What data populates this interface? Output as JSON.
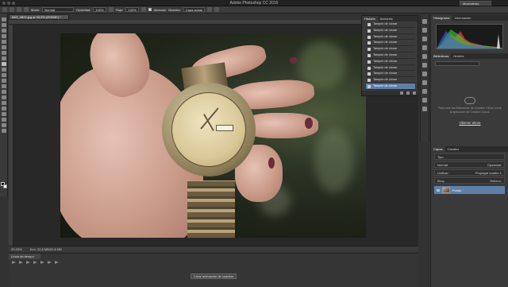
{
  "window": {
    "title": "Adobe Photoshop CC 2015",
    "workspace": "Movimiento"
  },
  "options_bar": {
    "mode_label": "Modo:",
    "mode_value": "Normal",
    "opacity_label": "Opacidad:",
    "opacity_value": "100%",
    "flow_label": "Flujo:",
    "flow_value": "100%",
    "aligned_label": "Alineado",
    "sample_label": "Muestra:",
    "sample_value": "Capa actual"
  },
  "document": {
    "tab_title": "IMG_0822.jpg al 33,3% (RGB/8*) *",
    "zoom": "33,33%",
    "doc_info": "Doc: 22,8 MB/22,8 MB"
  },
  "history_panel": {
    "tabs": [
      "Historia",
      "Acciones"
    ],
    "items": [
      "Tampón de clonar",
      "Tampón de clonar",
      "Tampón de clonar",
      "Tampón de clonar",
      "Tampón de clonar",
      "Tampón de clonar",
      "Tampón de clonar",
      "Tampón de clonar",
      "Tampón de clonar",
      "Tampón de clonar",
      "Tampón de clonar"
    ],
    "selected_index": 10
  },
  "histogram_panel": {
    "tabs": [
      "Histograma",
      "Información"
    ]
  },
  "libraries_panel": {
    "tabs": [
      "Bibliotecas",
      "Niveles"
    ],
    "message": "Para usar las Bibliotecas de Creative Cloud, inicie la aplicación de Creative Cloud.",
    "link": "Obtener ahora"
  },
  "layers_panel": {
    "tabs": [
      "Capas",
      "Canales"
    ],
    "filter_label": "Tipo",
    "blend_mode": "Normal",
    "opacity_label": "Opacidad:",
    "lock_label": "Bloq.:",
    "unify_label": "Unificar:",
    "propagate_label": "Propagar cuadro 1",
    "fill_label": "Relleno:",
    "layer_name": "Fondo"
  },
  "timeline_panel": {
    "tab": "Línea de tiempo",
    "create_button": "Crear animación de cuadros"
  }
}
